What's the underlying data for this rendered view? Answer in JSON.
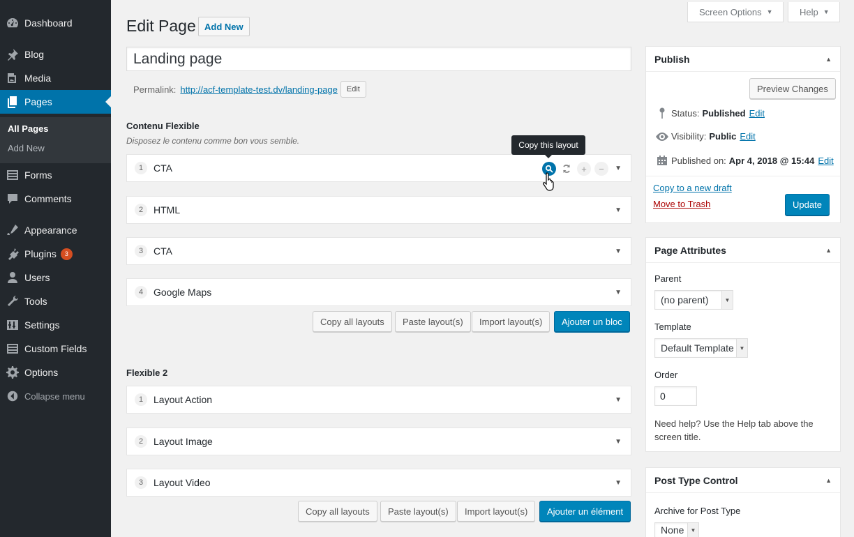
{
  "sidebar": {
    "items": [
      {
        "label": "Dashboard",
        "icon": "dashboard-icon"
      },
      {
        "label": "Blog",
        "icon": "pin-icon"
      },
      {
        "label": "Media",
        "icon": "media-icon"
      },
      {
        "label": "Pages",
        "icon": "pages-icon"
      },
      {
        "label": "Forms",
        "icon": "forms-icon"
      },
      {
        "label": "Comments",
        "icon": "comments-icon"
      },
      {
        "label": "Appearance",
        "icon": "appearance-icon"
      },
      {
        "label": "Plugins",
        "icon": "plugins-icon",
        "badge": "3"
      },
      {
        "label": "Users",
        "icon": "users-icon"
      },
      {
        "label": "Tools",
        "icon": "tools-icon"
      },
      {
        "label": "Settings",
        "icon": "settings-icon"
      },
      {
        "label": "Custom Fields",
        "icon": "custom-fields-icon"
      },
      {
        "label": "Options",
        "icon": "options-icon"
      }
    ],
    "submenu": [
      "All Pages",
      "Add New"
    ],
    "collapse": "Collapse menu",
    "active_color": "#0073aa"
  },
  "topbar": {
    "screen_options": "Screen Options",
    "help": "Help"
  },
  "header": {
    "title": "Edit Page",
    "add_new": "Add New"
  },
  "post": {
    "title": "Landing page",
    "permalink_label": "Permalink:",
    "permalink_url": "http://acf-template-test.dv/landing-page",
    "permalink_edit": "Edit"
  },
  "flex1": {
    "label": "Contenu Flexible",
    "description": "Disposez le contenu comme bon vous semble.",
    "layouts": [
      {
        "order": "1",
        "name": "CTA"
      },
      {
        "order": "2",
        "name": "HTML"
      },
      {
        "order": "3",
        "name": "CTA"
      },
      {
        "order": "4",
        "name": "Google Maps"
      }
    ],
    "tooltip": "Copy this layout",
    "copy_all": "Copy all layouts",
    "paste": "Paste layout(s)",
    "import": "Import layout(s)",
    "add": "Ajouter un bloc"
  },
  "flex2": {
    "label": "Flexible 2",
    "layouts": [
      {
        "order": "1",
        "name": "Layout Action"
      },
      {
        "order": "2",
        "name": "Layout Image"
      },
      {
        "order": "3",
        "name": "Layout Video"
      }
    ],
    "copy_all": "Copy all layouts",
    "paste": "Paste layout(s)",
    "import": "Import layout(s)",
    "add": "Ajouter un élément"
  },
  "publish": {
    "title": "Publish",
    "preview": "Preview Changes",
    "status_label": "Status:",
    "status_value": "Published",
    "visibility_label": "Visibility:",
    "visibility_value": "Public",
    "published_label": "Published on:",
    "published_value": "Apr 4, 2018 @ 15:44",
    "edit": "Edit",
    "copy_draft": "Copy to a new draft",
    "trash": "Move to Trash",
    "update": "Update"
  },
  "page_attributes": {
    "title": "Page Attributes",
    "parent_label": "Parent",
    "parent_value": "(no parent)",
    "template_label": "Template",
    "template_value": "Default Template",
    "order_label": "Order",
    "order_value": "0",
    "help": "Need help? Use the Help tab above the screen title."
  },
  "post_type_control": {
    "title": "Post Type Control",
    "archive_label": "Archive for Post Type",
    "archive_value": "None"
  }
}
